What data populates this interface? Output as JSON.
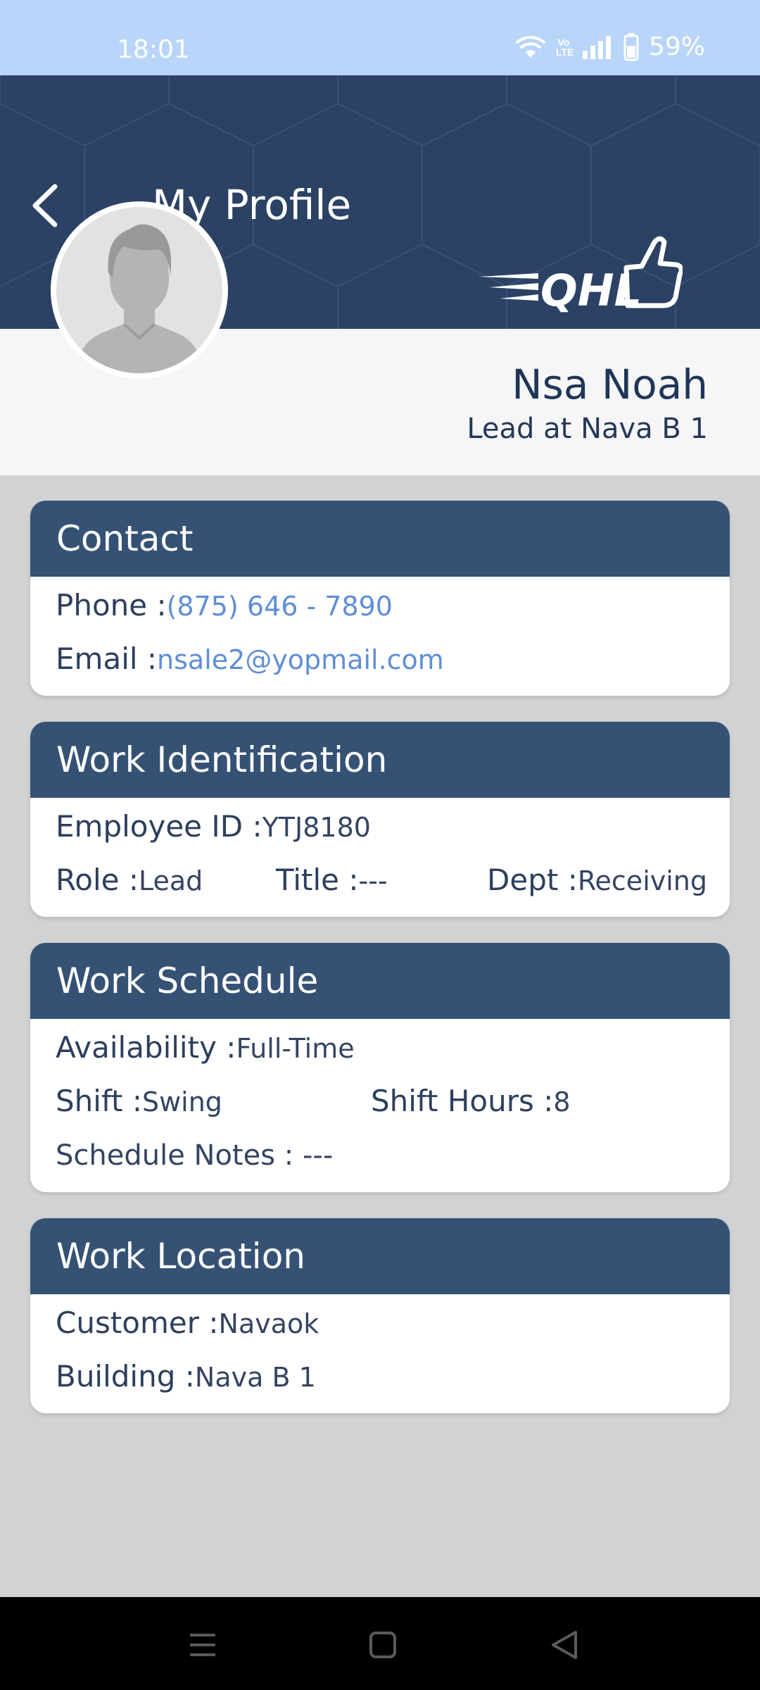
{
  "status_bar": {
    "time": "18:01",
    "battery": "59%",
    "volte": "Vo\nLTE"
  },
  "header": {
    "title": "My Profile"
  },
  "logo": {
    "text": "QHL"
  },
  "profile": {
    "name": "Nsa Noah",
    "subtitle": "Lead at Nava B 1"
  },
  "contact": {
    "heading": "Contact",
    "phone_label": "Phone :",
    "phone_value": "(875) 646 - 7890",
    "email_label": "Email :",
    "email_value": "nsale2@yopmail.com"
  },
  "work_identification": {
    "heading": "Work Identification",
    "employee_id_label": "Employee ID :",
    "employee_id_value": "YTJ8180",
    "role_label": "Role :",
    "role_value": "Lead",
    "title_label": "Title :",
    "title_value": "---",
    "dept_label": "Dept :",
    "dept_value": "Receiving"
  },
  "work_schedule": {
    "heading": "Work Schedule",
    "availability_label": "Availability :",
    "availability_value": "Full-Time",
    "shift_label": "Shift :",
    "shift_value": "Swing",
    "shift_hours_label": "Shift Hours :",
    "shift_hours_value": "8",
    "schedule_notes": "Schedule Notes : ---"
  },
  "work_location": {
    "heading": "Work Location",
    "customer_label": "Customer :",
    "customer_value": "Navaok",
    "building_label": "Building :",
    "building_value": "Nava B 1"
  },
  "colors": {
    "header_bg": "#2b4265",
    "card_head": "#355275",
    "link": "#5f8ed6",
    "status_bar": "#b9d5f9"
  },
  "icons": [
    "wifi-icon",
    "signal-icon",
    "battery-icon",
    "back-arrow-icon",
    "avatar-placeholder-icon",
    "menu-nav-icon",
    "home-nav-icon",
    "back-nav-icon"
  ]
}
